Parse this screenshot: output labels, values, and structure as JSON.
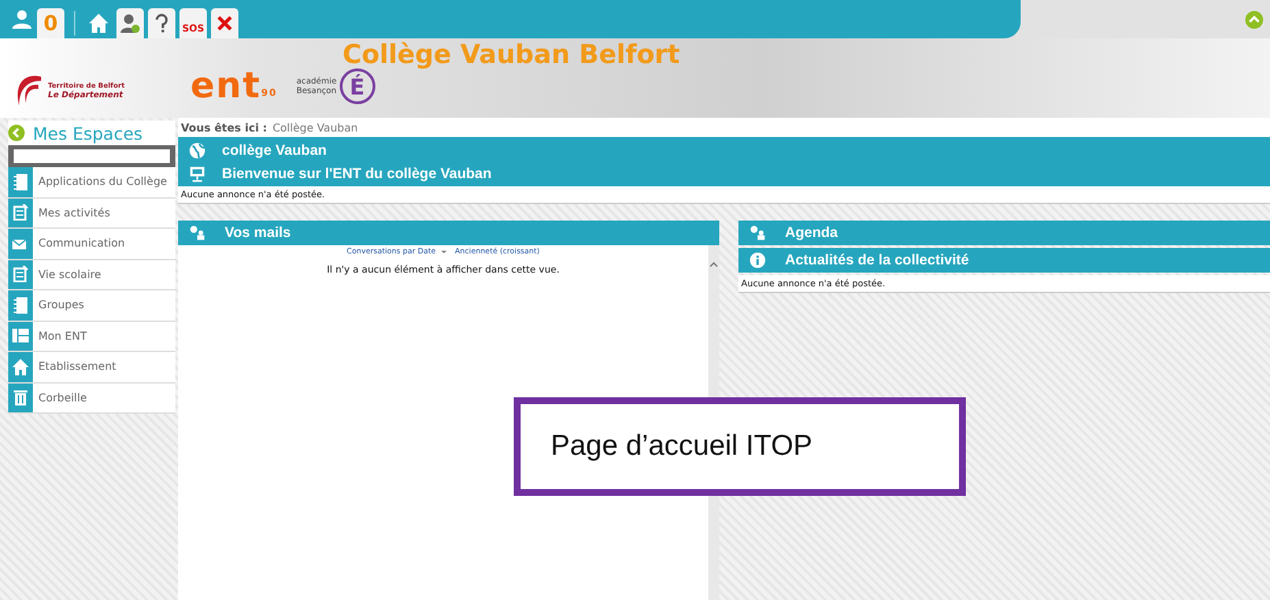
{
  "toolbar": {
    "counter": "0",
    "sos": "SOS"
  },
  "header": {
    "school_title": "Collège Vauban Belfort",
    "dept_logo": [
      "Territoire de Belfort",
      "Le Département"
    ],
    "ent_logo": "ent",
    "ent_suffix": "90",
    "academy": [
      "académie",
      "Besançon"
    ],
    "academy_letter": "É"
  },
  "sidebar": {
    "title": "Mes Espaces",
    "items": [
      {
        "label": "Applications du Collège",
        "kind": "notebook"
      },
      {
        "label": "Mes activités",
        "kind": "clipboard"
      },
      {
        "label": "Communication",
        "kind": "mail"
      },
      {
        "label": "Vie scolaire",
        "kind": "clipboard"
      },
      {
        "label": "Groupes",
        "kind": "notebook"
      },
      {
        "label": "Mon ENT",
        "kind": "layout"
      },
      {
        "label": "Etablissement",
        "kind": "home"
      },
      {
        "label": "Corbeille",
        "kind": "trash"
      }
    ]
  },
  "breadcrumb": {
    "label": "Vous êtes ici :",
    "value": "Collège Vauban"
  },
  "welcome": {
    "title": "collège Vauban",
    "subtitle": "Bienvenue sur l'ENT du collège Vauban",
    "message": "Aucune annonce n'a été postée."
  },
  "mails": {
    "title": "Vos mails",
    "sort_by": "Conversations par Date",
    "order": "Ancienneté (croissant)",
    "empty": "Il n'y a aucun élément à afficher dans cette vue."
  },
  "agenda": {
    "title": "Agenda"
  },
  "news": {
    "title": "Actualités de la collectivité",
    "message": "Aucune annonce n'a été postée."
  },
  "annotation": "Page d’accueil ITOP"
}
